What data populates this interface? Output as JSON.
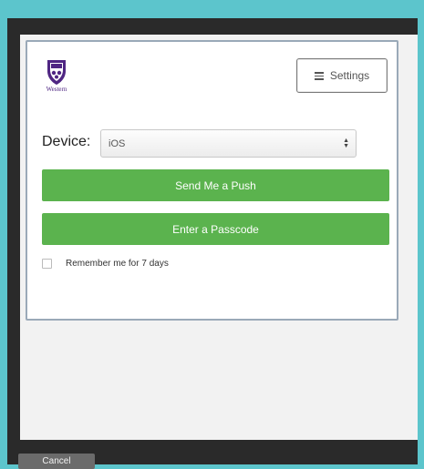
{
  "logo": {
    "text": "Western",
    "icon": "western-crest-icon",
    "color": "#4f2683"
  },
  "settings": {
    "label": "Settings",
    "icon": "hamburger-icon"
  },
  "device": {
    "label": "Device:",
    "selected": "iOS",
    "icon": "select-arrows-icon"
  },
  "actions": {
    "push_label": "Send Me a Push",
    "passcode_label": "Enter a Passcode",
    "accent": "#5bb34e"
  },
  "remember": {
    "label": "Remember me for 7 days",
    "checked": false
  },
  "footer": {
    "cancel_label": "Cancel"
  }
}
